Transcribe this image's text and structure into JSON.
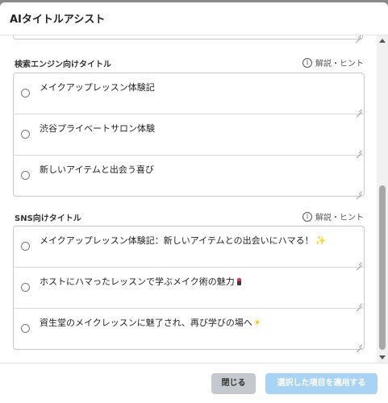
{
  "dialog": {
    "title": "AIタイトルアシスト"
  },
  "sections": [
    {
      "title": "検索エンジン向けタイトル",
      "hint": "解説・ヒント",
      "options": [
        "メイクアップレッスン体験記",
        "渋谷プライベートサロン体験",
        "新しいアイテムと出会う喜び"
      ]
    },
    {
      "title": "SNS向けタイトル",
      "hint": "解説・ヒント",
      "options": [
        "メイクアップレッスン体験記：新しいアイテムとの出会いにハマる！",
        "ホストにハマったレッスンで学ぶメイク術の魅力",
        "資生堂のメイクレッスンに魅了され、再び学びの場へ"
      ],
      "option_icons": [
        "sparkles-icon",
        "lipstick-icon",
        "sun-icon"
      ]
    }
  ],
  "footer": {
    "close_label": "閉じる",
    "apply_label": "選択した項目を適用する"
  },
  "colors": {
    "apply_button": "#a9d3f5",
    "close_button": "#c4c9cf"
  }
}
